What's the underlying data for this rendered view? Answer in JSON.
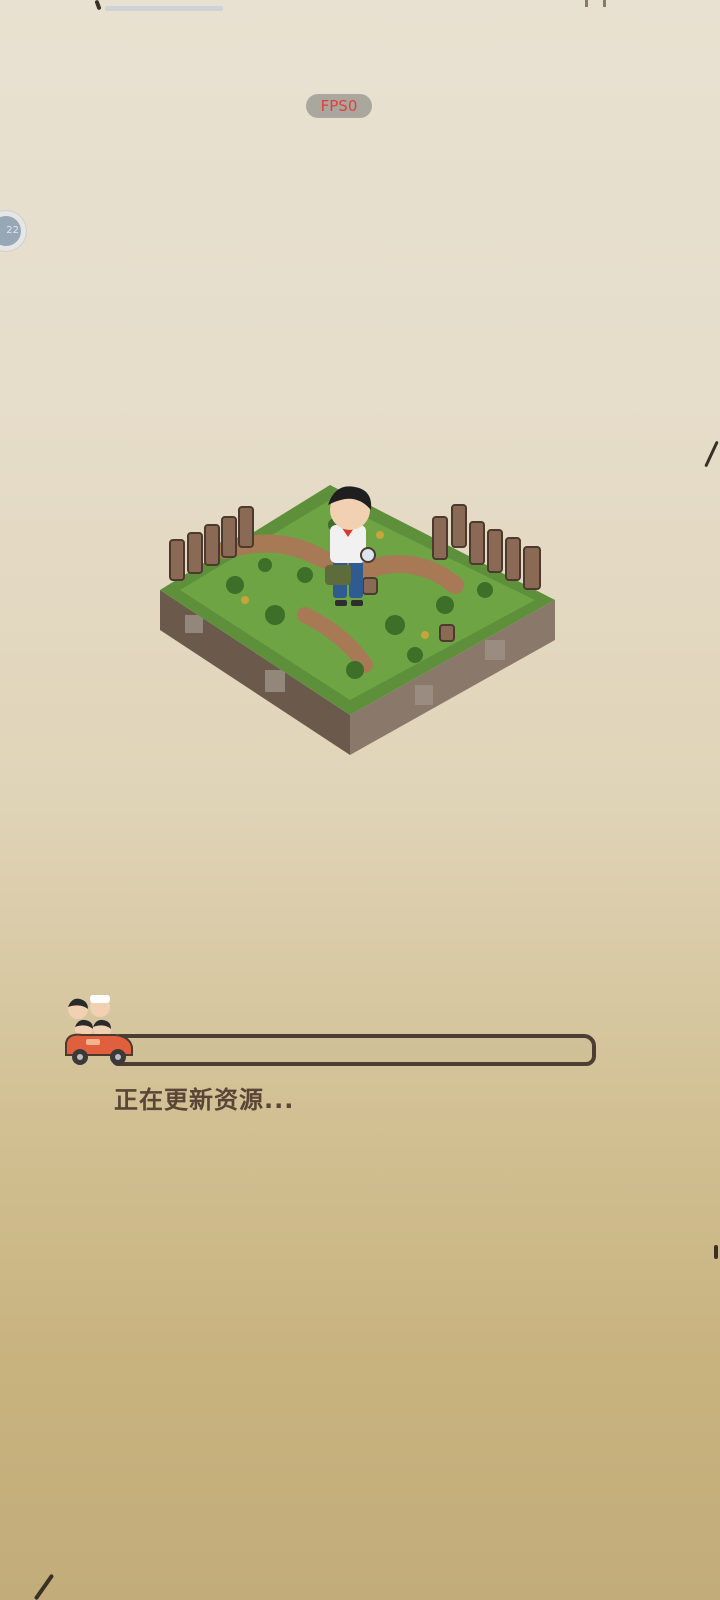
{
  "overlay": {
    "fps_label": "FPS0",
    "debug_bubble_text": "22"
  },
  "loading": {
    "status_text": "正在更新资源...",
    "progress": 0
  },
  "scene": {
    "illustration": "isometric-grass-tile-with-boy-holding-magnifying-glass",
    "loader_icon": "car-with-characters-icon"
  },
  "colors": {
    "background_top": "#e8e1d1",
    "background_bottom": "#c2ad7a",
    "progress_border": "#4d3d32",
    "text": "#5a4536",
    "fps_text": "#e0403a"
  }
}
